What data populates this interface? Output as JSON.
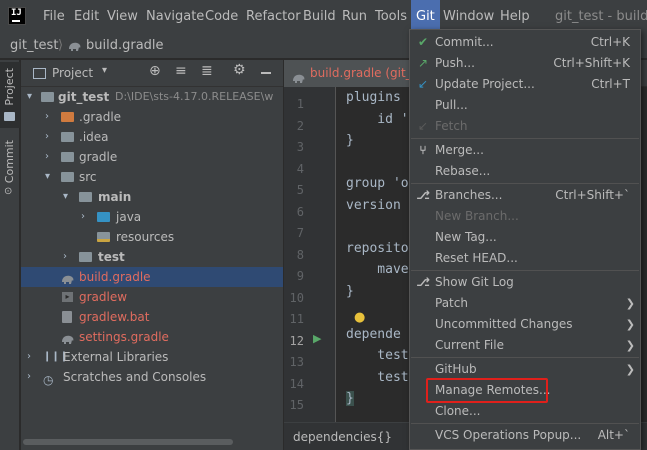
{
  "menubar": {
    "logo": "IJ",
    "items": [
      "File",
      "Edit",
      "View",
      "Navigate",
      "Code",
      "Refactor",
      "Build",
      "Run",
      "Tools",
      "Git",
      "Window",
      "Help"
    ],
    "title": "git_test - build.gr"
  },
  "breadcrumb": {
    "project": "git_test",
    "file": "build.gradle"
  },
  "toolstrip": {
    "project_tab": "Project",
    "commit_tab": "Commit"
  },
  "project_panel": {
    "title": "Project",
    "tree": {
      "root": "git_test",
      "root_path": "D:\\IDE\\sts-4.17.0.RELEASE\\w",
      "gradle_dot": ".gradle",
      "idea": ".idea",
      "gradle": "gradle",
      "src": "src",
      "main": "main",
      "java": "java",
      "resources": "resources",
      "test": "test",
      "build_gradle": "build.gradle",
      "gradlew": "gradlew",
      "gradlew_bat": "gradlew.bat",
      "settings_gradle": "settings.gradle",
      "external_libraries": "External Libraries",
      "scratches": "Scratches and Consoles"
    }
  },
  "editor": {
    "tab": "build.gradle (git_te",
    "line_numbers": [
      "1",
      "2",
      "3",
      "4",
      "5",
      "6",
      "7",
      "8",
      "9",
      "10",
      "11",
      "12",
      "13",
      "14",
      "15"
    ],
    "code": {
      "l1": "plugins",
      "l2": "    id '",
      "l3": "}",
      "l5": "group 'o",
      "l6": "version",
      "l8": "reposito",
      "l9": "    mave",
      "l10": "}",
      "l12": "depende",
      "l13": "    test",
      "l14": "    test",
      "l15": "}"
    },
    "breadcrumb": "dependencies{}"
  },
  "git_menu": {
    "items": [
      {
        "label": "Commit...",
        "shortcut": "Ctrl+K",
        "icon": "check-icon"
      },
      {
        "label": "Push...",
        "shortcut": "Ctrl+Shift+K",
        "icon": "push-arrow-icon"
      },
      {
        "label": "Update Project...",
        "shortcut": "Ctrl+T",
        "icon": "update-arrow-icon"
      },
      {
        "label": "Pull..."
      },
      {
        "label": "Fetch",
        "disabled": true,
        "icon": "fetch-icon"
      },
      {
        "label": "Merge...",
        "icon": "merge-icon"
      },
      {
        "label": "Rebase..."
      },
      {
        "label": "Branches...",
        "shortcut": "Ctrl+Shift+`",
        "icon": "branch-icon"
      },
      {
        "label": "New Branch...",
        "disabled": true
      },
      {
        "label": "New Tag..."
      },
      {
        "label": "Reset HEAD..."
      },
      {
        "label": "Show Git Log",
        "icon": "log-branch-icon"
      },
      {
        "label": "Patch",
        "submenu": true
      },
      {
        "label": "Uncommitted Changes",
        "submenu": true
      },
      {
        "label": "Current File",
        "submenu": true
      },
      {
        "label": "GitHub",
        "submenu": true
      },
      {
        "label": "Manage Remotes..."
      },
      {
        "label": "Clone..."
      },
      {
        "label": "VCS Operations Popup...",
        "shortcut": "Alt+`"
      }
    ]
  },
  "colors": {
    "accent": "#4b6eaf",
    "highlight_box": "#e0201b",
    "modified_file": "#e06c5f",
    "check_green": "#59a869",
    "update_blue": "#3592c4"
  }
}
